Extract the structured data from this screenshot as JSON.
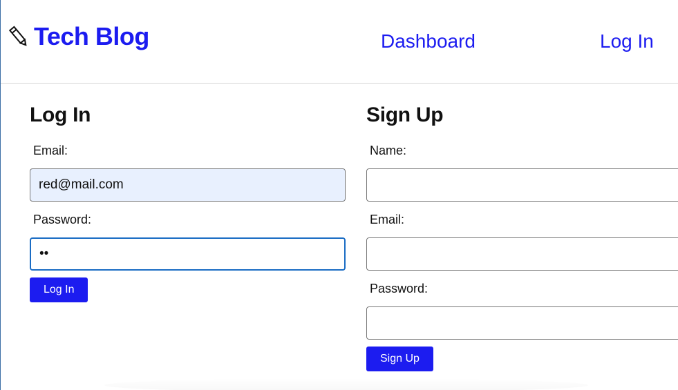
{
  "header": {
    "brand_title": "Tech Blog",
    "brand_icon": "pencil-icon",
    "nav": {
      "dashboard": "Dashboard",
      "login": "Log In"
    }
  },
  "login_form": {
    "title": "Log In",
    "email_label": "Email:",
    "email_value": "red@mail.com",
    "password_label": "Password:",
    "password_value": "ab",
    "submit_label": "Log In"
  },
  "signup_form": {
    "title": "Sign Up",
    "name_label": "Name:",
    "name_value": "",
    "email_label": "Email:",
    "email_value": "",
    "password_label": "Password:",
    "password_value": "",
    "submit_label": "Sign Up"
  },
  "colors": {
    "accent": "#1c1cf0",
    "autofill_bg": "#e8f0fe",
    "focus_border": "#1a6cc4"
  }
}
